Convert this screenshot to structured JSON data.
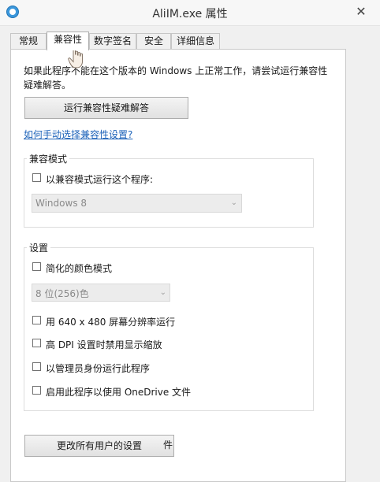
{
  "window": {
    "title": "AliIM.exe 属性",
    "close_glyph": "✕"
  },
  "tabs": [
    {
      "label": "常规"
    },
    {
      "label": "兼容性"
    },
    {
      "label": "数字签名"
    },
    {
      "label": "安全"
    },
    {
      "label": "详细信息"
    }
  ],
  "active_tab": "兼容性",
  "intro_text": "如果此程序不能在这个版本的 Windows 上正常工作，请尝试运行兼容性疑难解答。",
  "troubleshooter_button": "运行兼容性疑难解答",
  "manual_link": "如何手动选择兼容性设置?",
  "compat_mode": {
    "legend": "兼容模式",
    "checkbox_label": "以兼容模式运行这个程序:",
    "checked": false,
    "os_select": "Windows 8"
  },
  "settings": {
    "legend": "设置",
    "reduced_color": {
      "label": "简化的颜色模式",
      "checked": false
    },
    "color_select": "8 位(256)色",
    "res_640": {
      "label": "用 640 x 480 屏幕分辨率运行",
      "checked": false
    },
    "high_dpi": {
      "label": "高 DPI 设置时禁用显示缩放",
      "checked": false
    },
    "run_admin": {
      "label": "以管理员身份运行此程序",
      "checked": false
    },
    "onedrive": {
      "label": "启用此程序以使用 OneDrive 文件",
      "checked": false
    }
  },
  "all_users_button": "更改所有用户的设置",
  "partial_text": "件",
  "colors": {
    "link": "#1c62b9",
    "window_bg": "#f0f0f0",
    "panel_bg": "#ffffff"
  }
}
